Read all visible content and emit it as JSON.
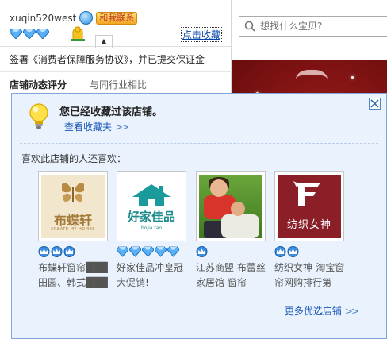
{
  "seller": {
    "name": "xuqin520west",
    "contact_label": "和我联系",
    "diamonds": 3,
    "favorite_link": "点击收藏"
  },
  "agreement_text": "签署《消费者保障服务协议》，并已提交保证金",
  "rating": {
    "title": "店铺动态评分",
    "compare_label": "与同行业相比"
  },
  "search": {
    "placeholder": "想找什么宝贝?"
  },
  "popup": {
    "confirm_text": "您已经收藏过该店铺。",
    "view_favorites": "查看收藏夹",
    "arrow": ">>",
    "also_like": "喜欢此店铺的人还喜欢：",
    "more_shops": "更多优选店铺",
    "shops": [
      {
        "name": "布蝶轩窗帘███田园、韩式███",
        "logo_text": "布蝶轩",
        "logo_sub": "CREATE MY HOMES",
        "level_icon": "crown-icon",
        "level_count": 3
      },
      {
        "name": "好家佳品冲皇冠大促销!",
        "logo_text": "好家佳品",
        "logo_sub": "hojia.tao",
        "level_icon": "diamond-icon",
        "level_count": 5
      },
      {
        "name": "江苏商盟 布蕾丝家居馆 窗帘",
        "logo_text": "",
        "logo_sub": "",
        "level_icon": "crown-icon",
        "level_count": 1
      },
      {
        "name": "纺织女神-淘宝窗帘网购排行第",
        "logo_text": "纺织女神",
        "logo_sub": "",
        "level_icon": "crown-icon",
        "level_count": 2
      }
    ]
  },
  "colors": {
    "popup_bg": "#eaf3fd",
    "popup_border": "#7fa8d8",
    "link_blue": "#1a56b8",
    "banner_red": "#a31d1d"
  }
}
